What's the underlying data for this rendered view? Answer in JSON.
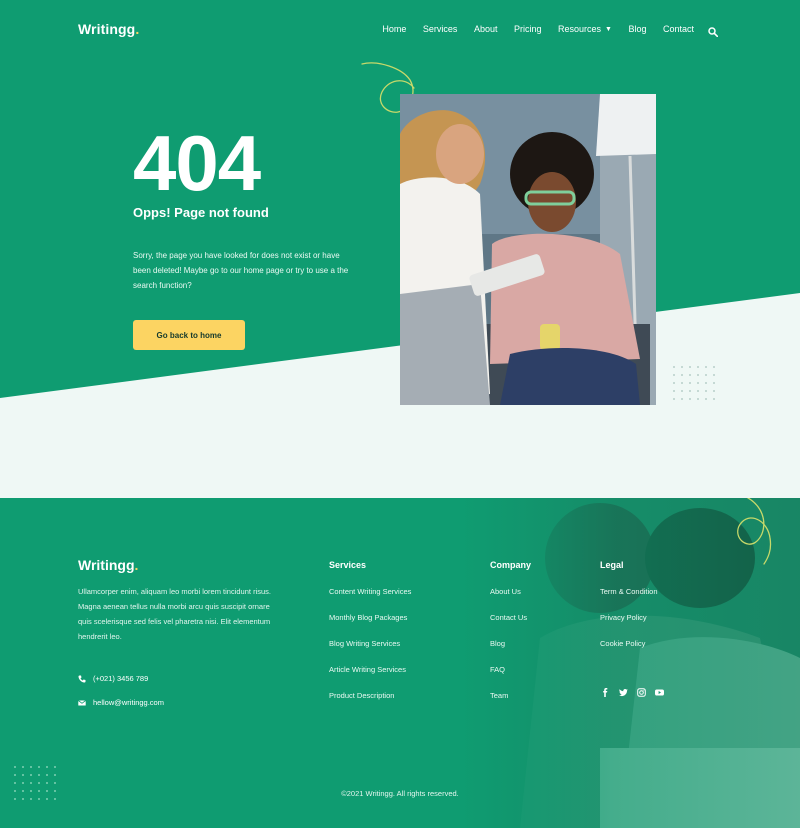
{
  "brand": {
    "name": "Writingg",
    "dot": "."
  },
  "nav": {
    "items": [
      "Home",
      "Services",
      "About",
      "Pricing",
      "Resources",
      "Blog",
      "Contact"
    ],
    "search_icon": "search-icon"
  },
  "hero": {
    "code": "404",
    "subtitle": "Opps! Page not found",
    "description": "Sorry, the page you have looked for does not exist or have been deleted! Maybe go to our home page or try to use a the search function?",
    "button": "Go back to home"
  },
  "footer": {
    "description": "Ullamcorper enim, aliquam leo morbi lorem tincidunt risus. Magna aenean tellus nulla morbi arcu quis suscipit ornare quis scelerisque sed felis vel pharetra nisi. Elit elementum hendrerit leo.",
    "phone": "(+021) 3456 789",
    "email": "hellow@writingg.com",
    "columns": {
      "services": {
        "title": "Services",
        "items": [
          "Content Writing Services",
          "Monthly Blog Packages",
          "Blog Writing Services",
          "Article Writing Services",
          "Product Description"
        ]
      },
      "company": {
        "title": "Company",
        "items": [
          "About Us",
          "Contact Us",
          "Blog",
          "FAQ",
          "Team"
        ]
      },
      "legal": {
        "title": "Legal",
        "items": [
          "Term & Condition",
          "Privacy Policy",
          "Cookie Policy"
        ]
      }
    },
    "social": [
      "facebook-icon",
      "twitter-icon",
      "instagram-icon",
      "youtube-icon"
    ],
    "copyright": "©2021 Writingg. All rights reserved."
  },
  "colors": {
    "primary": "#0f9c71",
    "accent": "#fcd462",
    "light_bg": "#eff8f5"
  }
}
